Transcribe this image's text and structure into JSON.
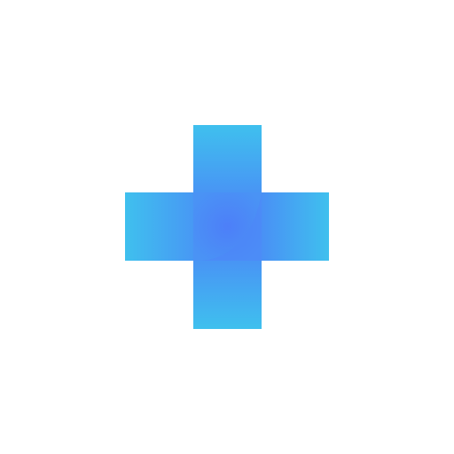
{
  "icon": {
    "name": "plus-icon",
    "colors": {
      "background": "#ffffff",
      "edge": "#3fc0ee",
      "middle": "#4a93f5",
      "center": "#4d7ff8"
    }
  }
}
